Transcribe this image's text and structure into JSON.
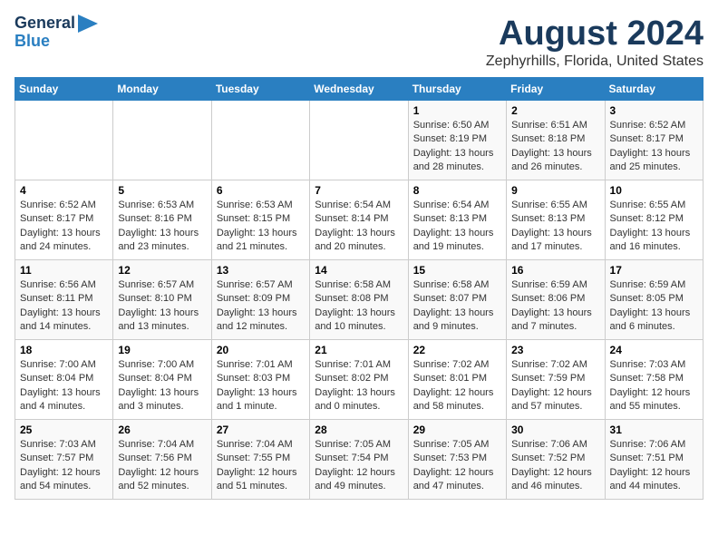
{
  "logo": {
    "line1": "General",
    "line2": "Blue"
  },
  "title": "August 2024",
  "subtitle": "Zephyrhills, Florida, United States",
  "days_of_week": [
    "Sunday",
    "Monday",
    "Tuesday",
    "Wednesday",
    "Thursday",
    "Friday",
    "Saturday"
  ],
  "weeks": [
    [
      {
        "day": "",
        "info": ""
      },
      {
        "day": "",
        "info": ""
      },
      {
        "day": "",
        "info": ""
      },
      {
        "day": "",
        "info": ""
      },
      {
        "day": "1",
        "info": "Sunrise: 6:50 AM\nSunset: 8:19 PM\nDaylight: 13 hours\nand 28 minutes."
      },
      {
        "day": "2",
        "info": "Sunrise: 6:51 AM\nSunset: 8:18 PM\nDaylight: 13 hours\nand 26 minutes."
      },
      {
        "day": "3",
        "info": "Sunrise: 6:52 AM\nSunset: 8:17 PM\nDaylight: 13 hours\nand 25 minutes."
      }
    ],
    [
      {
        "day": "4",
        "info": "Sunrise: 6:52 AM\nSunset: 8:17 PM\nDaylight: 13 hours\nand 24 minutes."
      },
      {
        "day": "5",
        "info": "Sunrise: 6:53 AM\nSunset: 8:16 PM\nDaylight: 13 hours\nand 23 minutes."
      },
      {
        "day": "6",
        "info": "Sunrise: 6:53 AM\nSunset: 8:15 PM\nDaylight: 13 hours\nand 21 minutes."
      },
      {
        "day": "7",
        "info": "Sunrise: 6:54 AM\nSunset: 8:14 PM\nDaylight: 13 hours\nand 20 minutes."
      },
      {
        "day": "8",
        "info": "Sunrise: 6:54 AM\nSunset: 8:13 PM\nDaylight: 13 hours\nand 19 minutes."
      },
      {
        "day": "9",
        "info": "Sunrise: 6:55 AM\nSunset: 8:13 PM\nDaylight: 13 hours\nand 17 minutes."
      },
      {
        "day": "10",
        "info": "Sunrise: 6:55 AM\nSunset: 8:12 PM\nDaylight: 13 hours\nand 16 minutes."
      }
    ],
    [
      {
        "day": "11",
        "info": "Sunrise: 6:56 AM\nSunset: 8:11 PM\nDaylight: 13 hours\nand 14 minutes."
      },
      {
        "day": "12",
        "info": "Sunrise: 6:57 AM\nSunset: 8:10 PM\nDaylight: 13 hours\nand 13 minutes."
      },
      {
        "day": "13",
        "info": "Sunrise: 6:57 AM\nSunset: 8:09 PM\nDaylight: 13 hours\nand 12 minutes."
      },
      {
        "day": "14",
        "info": "Sunrise: 6:58 AM\nSunset: 8:08 PM\nDaylight: 13 hours\nand 10 minutes."
      },
      {
        "day": "15",
        "info": "Sunrise: 6:58 AM\nSunset: 8:07 PM\nDaylight: 13 hours\nand 9 minutes."
      },
      {
        "day": "16",
        "info": "Sunrise: 6:59 AM\nSunset: 8:06 PM\nDaylight: 13 hours\nand 7 minutes."
      },
      {
        "day": "17",
        "info": "Sunrise: 6:59 AM\nSunset: 8:05 PM\nDaylight: 13 hours\nand 6 minutes."
      }
    ],
    [
      {
        "day": "18",
        "info": "Sunrise: 7:00 AM\nSunset: 8:04 PM\nDaylight: 13 hours\nand 4 minutes."
      },
      {
        "day": "19",
        "info": "Sunrise: 7:00 AM\nSunset: 8:04 PM\nDaylight: 13 hours\nand 3 minutes."
      },
      {
        "day": "20",
        "info": "Sunrise: 7:01 AM\nSunset: 8:03 PM\nDaylight: 13 hours\nand 1 minute."
      },
      {
        "day": "21",
        "info": "Sunrise: 7:01 AM\nSunset: 8:02 PM\nDaylight: 13 hours\nand 0 minutes."
      },
      {
        "day": "22",
        "info": "Sunrise: 7:02 AM\nSunset: 8:01 PM\nDaylight: 12 hours\nand 58 minutes."
      },
      {
        "day": "23",
        "info": "Sunrise: 7:02 AM\nSunset: 7:59 PM\nDaylight: 12 hours\nand 57 minutes."
      },
      {
        "day": "24",
        "info": "Sunrise: 7:03 AM\nSunset: 7:58 PM\nDaylight: 12 hours\nand 55 minutes."
      }
    ],
    [
      {
        "day": "25",
        "info": "Sunrise: 7:03 AM\nSunset: 7:57 PM\nDaylight: 12 hours\nand 54 minutes."
      },
      {
        "day": "26",
        "info": "Sunrise: 7:04 AM\nSunset: 7:56 PM\nDaylight: 12 hours\nand 52 minutes."
      },
      {
        "day": "27",
        "info": "Sunrise: 7:04 AM\nSunset: 7:55 PM\nDaylight: 12 hours\nand 51 minutes."
      },
      {
        "day": "28",
        "info": "Sunrise: 7:05 AM\nSunset: 7:54 PM\nDaylight: 12 hours\nand 49 minutes."
      },
      {
        "day": "29",
        "info": "Sunrise: 7:05 AM\nSunset: 7:53 PM\nDaylight: 12 hours\nand 47 minutes."
      },
      {
        "day": "30",
        "info": "Sunrise: 7:06 AM\nSunset: 7:52 PM\nDaylight: 12 hours\nand 46 minutes."
      },
      {
        "day": "31",
        "info": "Sunrise: 7:06 AM\nSunset: 7:51 PM\nDaylight: 12 hours\nand 44 minutes."
      }
    ]
  ]
}
